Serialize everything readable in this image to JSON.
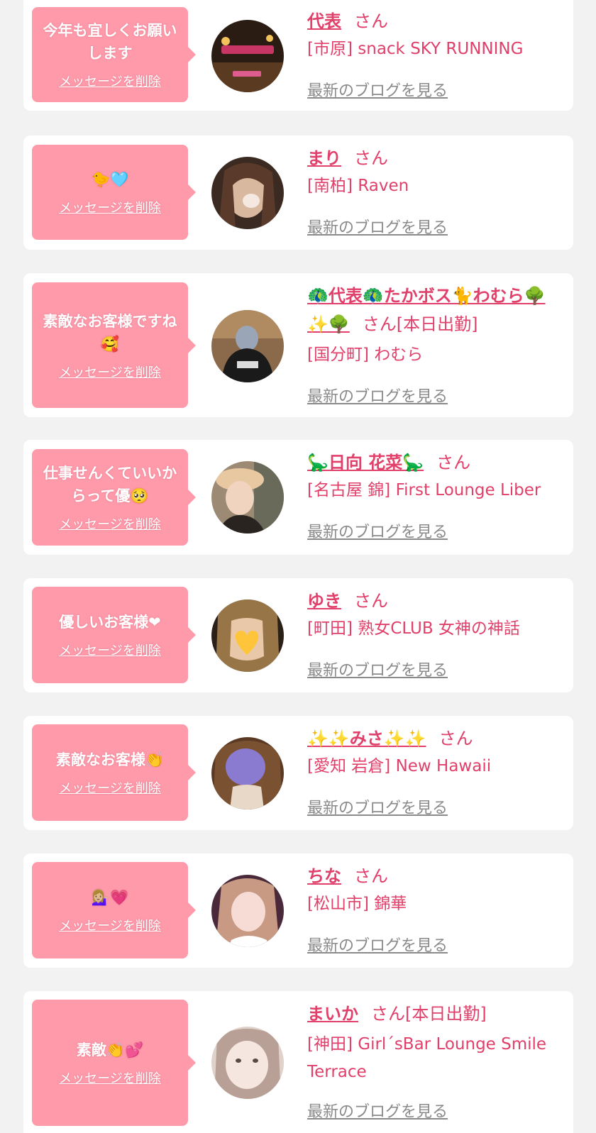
{
  "delete_label": "メッセージを削除",
  "blog_label": "最新のブログを見る",
  "entries": [
    {
      "message": "今年も宜しくお願いします",
      "name": "代表",
      "suffix": "さん",
      "store": "[市原] snack SKY RUNNING"
    },
    {
      "message": "🐤🩵",
      "name": "まり",
      "suffix": "さん",
      "store": "[南柏] Raven"
    },
    {
      "message": "素敵なお客様ですね🥰",
      "name": "🦚代表🦚たかボス🐈わむら🌳✨🌳",
      "suffix": "さん[本日出勤]",
      "store": "[国分町] わむら"
    },
    {
      "message": "仕事せんくていいからって優🥺",
      "name": "🦕日向 花菜🦕",
      "suffix": "さん",
      "store": "[名古屋 錦] First Lounge Liber"
    },
    {
      "message": "優しいお客様❤",
      "name": "ゆき",
      "suffix": "さん",
      "store": "[町田] 熟女CLUB 女神の神話"
    },
    {
      "message": "素敵なお客様👏",
      "name": "✨✨みさ✨✨",
      "suffix": "さん",
      "store": "[愛知 岩倉] New Hawaii"
    },
    {
      "message": "💁🏼‍♀️💗",
      "name": "ちな",
      "suffix": "さん",
      "store": "[松山市] 錦華"
    },
    {
      "message": "素敵👏💕",
      "name": "まいか",
      "suffix": "さん[本日出勤]",
      "store": "[神田] Girl´sBar Lounge Smile Terrace"
    }
  ]
}
